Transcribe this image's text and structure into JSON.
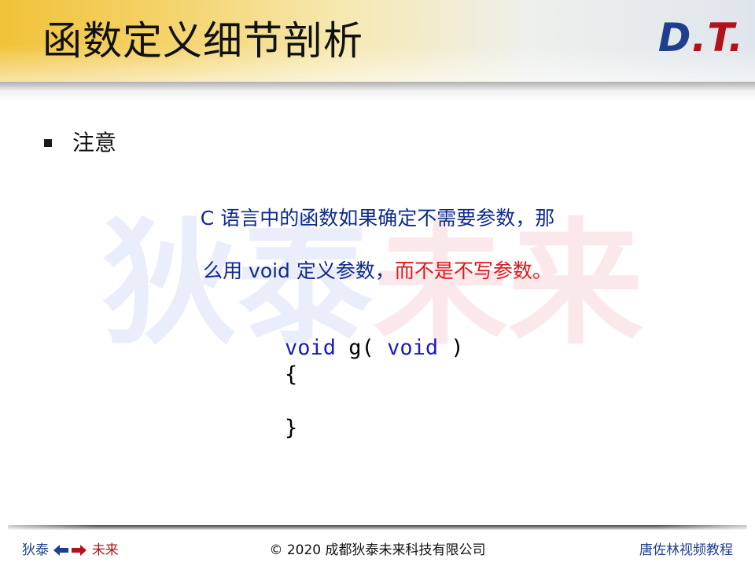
{
  "header": {
    "title": "函数定义细节剖析",
    "logo": {
      "d": "D",
      "dot": ".",
      "t": "T",
      "dot2": "."
    }
  },
  "watermark": {
    "left": "狄泰",
    "right": "未来"
  },
  "content": {
    "bullet": "注意",
    "desc_line1": "C 语言中的函数如果确定不需要参数，那",
    "desc_line2_normal": "么用 void 定义参数，",
    "desc_line2_emph": "而不是不写参数。",
    "code": {
      "line1_kw1": "void",
      "line1_mid": " g( ",
      "line1_kw2": "void",
      "line1_end": " )",
      "line2": "{",
      "line3": "",
      "line4": "}"
    }
  },
  "footer": {
    "left_a": "狄泰",
    "left_b": "未来",
    "center": "© 2020 成都狄泰未来科技有限公司",
    "right": "唐佐林视频教程"
  },
  "colors": {
    "title_band": "#f1c23a",
    "brand_blue": "#1f3f8c",
    "brand_red": "#b3121d",
    "text_blue": "#0e2a8c",
    "emphasis_red": "#e2141c",
    "keyword_blue": "#1b1bb8"
  },
  "icons": {
    "bullet": "square-bullet-icon",
    "arrow_left": "arrow-left-icon",
    "arrow_right": "arrow-right-icon"
  }
}
